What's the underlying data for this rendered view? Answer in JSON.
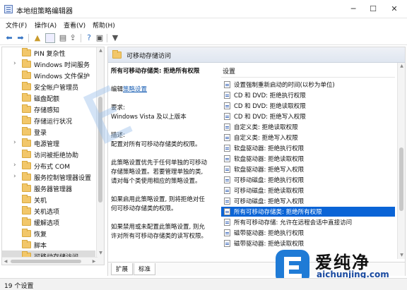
{
  "window": {
    "title": "本地组策略编辑器",
    "controls": {
      "minimize": "─",
      "maximize": "☐",
      "close": "✕"
    }
  },
  "menubar": {
    "items": [
      {
        "label": "文件(F)"
      },
      {
        "label": "操作(A)"
      },
      {
        "label": "查看(V)"
      },
      {
        "label": "帮助(H)"
      }
    ]
  },
  "toolbar": {
    "icons": [
      "back-icon",
      "forward-icon",
      "up-folder-icon",
      "show-tree-icon",
      "properties-icon",
      "export-list-icon",
      "help-icon",
      "console-icon",
      "filter-icon"
    ]
  },
  "tree": {
    "items": [
      {
        "label": "PIN 复杂性",
        "level": 1,
        "expandable": false
      },
      {
        "label": "Windows 时间服务",
        "level": 1,
        "expandable": true
      },
      {
        "label": "Windows 文件保护",
        "level": 1,
        "expandable": false
      },
      {
        "label": "安全帐户管理员",
        "level": 1,
        "expandable": false
      },
      {
        "label": "磁盘配额",
        "level": 1,
        "expandable": false
      },
      {
        "label": "存储感知",
        "level": 1,
        "expandable": false
      },
      {
        "label": "存储运行状况",
        "level": 1,
        "expandable": false
      },
      {
        "label": "登录",
        "level": 1,
        "expandable": false
      },
      {
        "label": "电源管理",
        "level": 1,
        "expandable": true
      },
      {
        "label": "访问被拒绝协助",
        "level": 1,
        "expandable": false
      },
      {
        "label": "分布式 COM",
        "level": 1,
        "expandable": true
      },
      {
        "label": "服务控制管理器设置",
        "level": 1,
        "expandable": true
      },
      {
        "label": "服务器管理器",
        "level": 1,
        "expandable": false
      },
      {
        "label": "关机",
        "level": 1,
        "expandable": false
      },
      {
        "label": "关机选项",
        "level": 1,
        "expandable": false
      },
      {
        "label": "缓解选项",
        "level": 1,
        "expandable": false
      },
      {
        "label": "恢复",
        "level": 1,
        "expandable": false
      },
      {
        "label": "脚本",
        "level": 1,
        "expandable": false
      },
      {
        "label": "可移动存储访问",
        "level": 1,
        "expandable": false,
        "selected": true
      },
      {
        "label": "内核 DMA 保护",
        "level": 1,
        "expandable": false
      }
    ]
  },
  "right": {
    "header": "可移动存储访问",
    "description": {
      "title": "所有可移动存储类: 拒绝所有权限",
      "edit_prefix": "编辑",
      "edit_link": "策略设置",
      "lines": [
        {
          "text": "要求:",
          "line": 4
        },
        {
          "text": "Windows Vista 及以上版本",
          "line": 5
        },
        {
          "text": "描述:",
          "line": 7
        },
        {
          "text": "配置对所有可移动存储类的权限。",
          "line": 8
        },
        {
          "text": "此策略设置优先于任何单独的可移动",
          "line": 10
        },
        {
          "text": "存储策略设置。若要管理单独的类,",
          "line": 11
        },
        {
          "text": "请对每个类使用相应的策略设置。",
          "line": 12
        },
        {
          "text": "如果启用此策略设置, 则将拒绝对任",
          "line": 14
        },
        {
          "text": "何可移动存储类的权限。",
          "line": 15
        },
        {
          "text": "如果禁用或未配置此策略设置, 则允",
          "line": 17
        },
        {
          "text": "许对所有可移动存储类的读写权限。",
          "line": 18
        }
      ]
    },
    "settings": {
      "header": "设置",
      "rows": [
        {
          "label": "设置强制重新启动的时间(以秒为单位)"
        },
        {
          "label": "CD 和 DVD: 拒绝执行权限"
        },
        {
          "label": "CD 和 DVD: 拒绝读取权限"
        },
        {
          "label": "CD 和 DVD: 拒绝写入权限"
        },
        {
          "label": "自定义类: 拒绝读取权限"
        },
        {
          "label": "自定义类: 拒绝写入权限"
        },
        {
          "label": "软盘驱动器: 拒绝执行权限"
        },
        {
          "label": "软盘驱动器: 拒绝读取权限"
        },
        {
          "label": "软盘驱动器: 拒绝写入权限"
        },
        {
          "label": "可移动磁盘: 拒绝执行权限"
        },
        {
          "label": "可移动磁盘: 拒绝读取权限"
        },
        {
          "label": "可移动磁盘: 拒绝写入权限"
        },
        {
          "label": "所有可移动存储类: 拒绝所有权限",
          "selected": true
        },
        {
          "label": "所有可移动存储: 允许在远程会话中直接访问"
        },
        {
          "label": "磁带驱动器: 拒绝执行权限"
        },
        {
          "label": "磁带驱动器: 拒绝读取权限"
        }
      ]
    },
    "tabs": [
      {
        "label": "扩展",
        "active": false
      },
      {
        "label": "标准",
        "active": true
      }
    ]
  },
  "status": {
    "text": "19 个设置"
  },
  "watermark": {
    "brand": "爱纯净",
    "url": "aichunjing.com"
  }
}
